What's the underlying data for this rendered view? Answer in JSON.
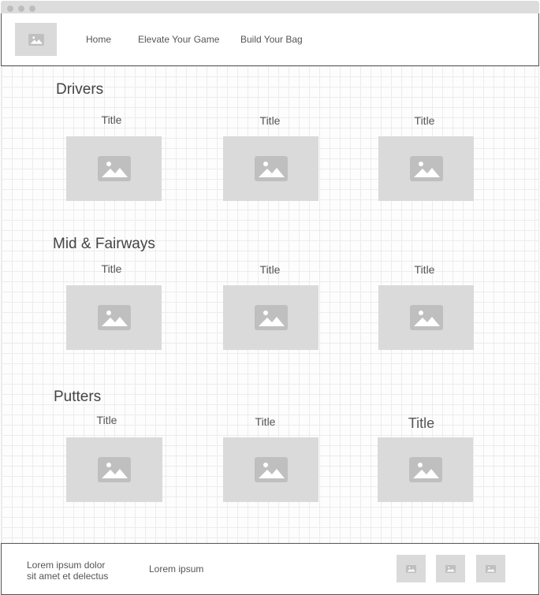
{
  "header": {
    "logo_icon": "image-placeholder-icon",
    "nav": [
      {
        "label": "Home"
      },
      {
        "label": "Elevate Your Game"
      },
      {
        "label": "Build Your Bag"
      }
    ]
  },
  "sections": [
    {
      "heading": "Drivers",
      "cards": [
        {
          "title": "Title",
          "icon": "image-placeholder-icon"
        },
        {
          "title": "Title",
          "icon": "image-placeholder-icon"
        },
        {
          "title": "Title",
          "icon": "image-placeholder-icon"
        }
      ]
    },
    {
      "heading": "Mid & Fairways",
      "cards": [
        {
          "title": "Title",
          "icon": "image-placeholder-icon"
        },
        {
          "title": "Title",
          "icon": "image-placeholder-icon"
        },
        {
          "title": "Title",
          "icon": "image-placeholder-icon"
        }
      ]
    },
    {
      "heading": "Putters",
      "cards": [
        {
          "title": "Title",
          "icon": "image-placeholder-icon"
        },
        {
          "title": "Title",
          "icon": "image-placeholder-icon"
        },
        {
          "title": "Title",
          "icon": "image-placeholder-icon"
        }
      ]
    }
  ],
  "footer": {
    "text_line1": "Lorem ipsum dolor",
    "text_line2": "sit amet et delectus",
    "link": "Lorem ipsum",
    "social_icons": [
      "image-placeholder-icon",
      "image-placeholder-icon",
      "image-placeholder-icon"
    ]
  },
  "colors": {
    "placeholder": "#dadada",
    "placeholder_glyph": "#bfbfbf",
    "border": "#555555",
    "grid": "#ececec"
  }
}
